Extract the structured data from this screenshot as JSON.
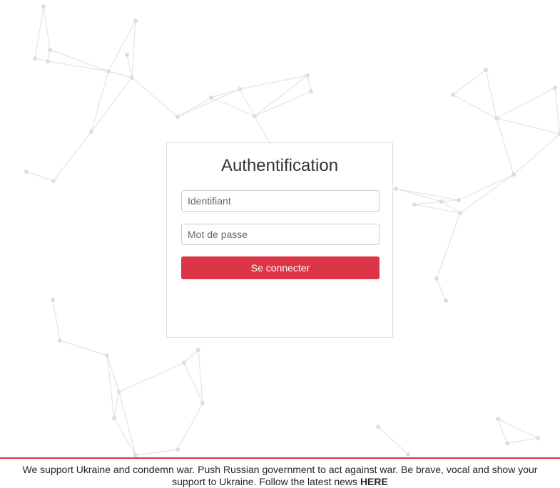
{
  "login": {
    "title": "Authentification",
    "username_placeholder": "Identifiant",
    "password_placeholder": "Mot de passe",
    "submit_label": "Se connecter"
  },
  "banner": {
    "text": "We support Ukraine and condemn war. Push Russian government to act against war. Be brave, vocal and show your support to Ukraine. Follow the latest news",
    "link_label": "HERE"
  },
  "colors": {
    "accent": "#dc3545",
    "network": "#dddddd"
  }
}
